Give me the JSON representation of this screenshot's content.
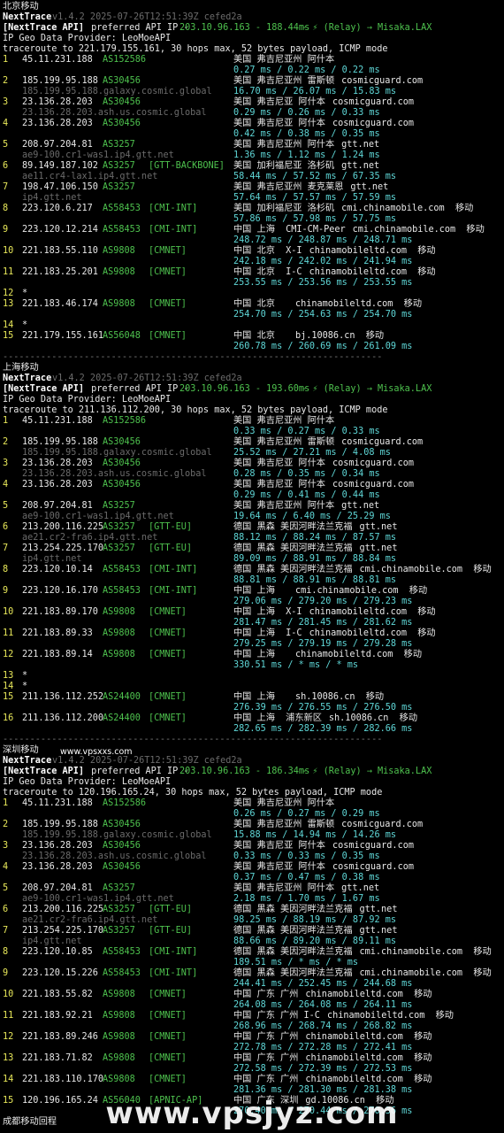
{
  "sections": [
    {
      "title": "北京移动",
      "app": "NextTrace",
      "version": "v1.4.2 2025-07-26T12:51:39Z cefed2a",
      "api_line": {
        "prefix": "[NextTrace API]",
        "text": " preferred API IP - ",
        "ip": "203.10.96.163 - 188.44ms",
        "relay": " - ⚡ (Relay) → Misaka.LAX"
      },
      "geo_provider": "IP Geo Data Provider: LeoMoeAPI",
      "traceroute": "traceroute to 221.179.155.161, 30 hops max, 52 bytes payload, ICMP mode",
      "hops": [
        {
          "n": "1",
          "ip": "45.11.231.188",
          "asn": "AS152586",
          "tag": "",
          "geo": "美国 弗吉尼亚州 阿什本",
          "org": "",
          "host": "",
          "rtt": "0.27 ms / 0.22 ms / 0.22 ms"
        },
        {
          "n": "2",
          "ip": "185.199.95.188",
          "asn": "AS30456",
          "tag": "",
          "geo": "美国 弗吉尼亚州 雷斯顿",
          "org": "cosmicguard.com",
          "host": "185.199.95.188.galaxy.cosmic.global",
          "rtt": "16.70 ms / 26.07 ms / 15.83 ms"
        },
        {
          "n": "3",
          "ip": "23.136.28.203",
          "asn": "AS30456",
          "tag": "",
          "geo": "美国 弗吉尼亚 阿什本",
          "org": "cosmicguard.com",
          "host": "23.136.28.203.ash.us.cosmic.global",
          "rtt": "0.29 ms / 0.26 ms / 0.33 ms"
        },
        {
          "n": "4",
          "ip": "23.136.28.203",
          "asn": "AS30456",
          "tag": "",
          "geo": "美国 弗吉尼亚 阿什本",
          "org": "cosmicguard.com",
          "host": "",
          "rtt": "0.42 ms / 0.38 ms / 0.35 ms"
        },
        {
          "n": "5",
          "ip": "208.97.204.81",
          "asn": "AS3257",
          "tag": "",
          "geo": "美国 弗吉尼亚州 阿什本",
          "org": "gtt.net",
          "host": "ae9-100.cr1-was1.ip4.gtt.net",
          "rtt": "1.36 ms / 1.12 ms / 1.24 ms"
        },
        {
          "n": "6",
          "ip": "89.149.187.102",
          "asn": "AS3257",
          "tag": "[GTT-BACKBONE]",
          "geo": "美国 加利福尼亚 洛杉矶",
          "org": "gtt.net",
          "host": "ae11.cr4-lax1.ip4.gtt.net",
          "rtt": "58.44 ms / 57.52 ms / 67.35 ms"
        },
        {
          "n": "7",
          "ip": "198.47.106.150",
          "asn": "AS3257",
          "tag": "",
          "geo": "美国 弗吉尼亚州 麦克莱恩",
          "org": "gtt.net",
          "host": "ip4.gtt.net",
          "rtt": "57.64 ms / 57.57 ms / 57.59 ms"
        },
        {
          "n": "8",
          "ip": "223.120.6.217",
          "asn": "AS58453",
          "tag": "[CMI-INT]",
          "geo": "美国 加利福尼亚 洛杉矶",
          "org": "cmi.chinamobile.com  移动",
          "host": "",
          "rtt": "57.86 ms / 57.98 ms / 57.75 ms"
        },
        {
          "n": "9",
          "ip": "223.120.12.214",
          "asn": "AS58453",
          "tag": "[CMI-INT]",
          "geo": "中国 上海  CMI-CM-Peer",
          "org": "cmi.chinamobile.com  移动",
          "host": "",
          "rtt": "248.72 ms / 248.87 ms / 248.71 ms"
        },
        {
          "n": "10",
          "ip": "221.183.55.110",
          "asn": "AS9808",
          "tag": "[CMNET]",
          "geo": "中国 北京  X-I",
          "org": "chinamobileltd.com  移动",
          "host": "",
          "rtt": "242.18 ms / 242.02 ms / 241.94 ms"
        },
        {
          "n": "11",
          "ip": "221.183.25.201",
          "asn": "AS9808",
          "tag": "[CMNET]",
          "geo": "中国 北京  I-C",
          "org": "chinamobileltd.com  移动",
          "host": "",
          "rtt": "253.55 ms / 253.56 ms / 253.55 ms"
        },
        {
          "n": "12",
          "ip": "*",
          "asn": "",
          "tag": "",
          "geo": "",
          "org": "",
          "host": "",
          "rtt": ""
        },
        {
          "n": "13",
          "ip": "221.183.46.174",
          "asn": "AS9808",
          "tag": "[CMNET]",
          "geo": "中国 北京",
          "org": "chinamobileltd.com  移动",
          "host": "",
          "rtt": "254.70 ms / 254.63 ms / 254.70 ms"
        },
        {
          "n": "14",
          "ip": "*",
          "asn": "",
          "tag": "",
          "geo": "",
          "org": "",
          "host": "",
          "rtt": ""
        },
        {
          "n": "15",
          "ip": "221.179.155.161",
          "asn": "AS56048",
          "tag": "[CMNET]",
          "geo": "中国 北京",
          "org": "bj.10086.cn  移动",
          "host": "",
          "rtt": "260.78 ms / 260.69 ms / 261.09 ms"
        }
      ]
    },
    {
      "title": "上海移动",
      "app": "NextTrace",
      "version": "v1.4.2 2025-07-26T12:51:39Z cefed2a",
      "api_line": {
        "prefix": "[NextTrace API]",
        "text": " preferred API IP - ",
        "ip": "203.10.96.163 - 193.60ms",
        "relay": " - ⚡ (Relay) → Misaka.LAX"
      },
      "geo_provider": "IP Geo Data Provider: LeoMoeAPI",
      "traceroute": "traceroute to 211.136.112.200, 30 hops max, 52 bytes payload, ICMP mode",
      "hops": [
        {
          "n": "1",
          "ip": "45.11.231.188",
          "asn": "AS152586",
          "tag": "",
          "geo": "美国 弗吉尼亚州 阿什本",
          "org": "",
          "host": "",
          "rtt": "0.33 ms / 0.27 ms / 0.33 ms"
        },
        {
          "n": "2",
          "ip": "185.199.95.188",
          "asn": "AS30456",
          "tag": "",
          "geo": "美国 弗吉尼亚州 雷斯顿",
          "org": "cosmicguard.com",
          "host": "185.199.95.188.galaxy.cosmic.global",
          "rtt": "25.52 ms / 27.21 ms / 4.08 ms"
        },
        {
          "n": "3",
          "ip": "23.136.28.203",
          "asn": "AS30456",
          "tag": "",
          "geo": "美国 弗吉尼亚 阿什本",
          "org": "cosmicguard.com",
          "host": "23.136.28.203.ash.us.cosmic.global",
          "rtt": "0.28 ms / 0.35 ms / 0.34 ms"
        },
        {
          "n": "4",
          "ip": "23.136.28.203",
          "asn": "AS30456",
          "tag": "",
          "geo": "美国 弗吉尼亚 阿什本",
          "org": "cosmicguard.com",
          "host": "",
          "rtt": "0.29 ms / 0.41 ms / 0.44 ms"
        },
        {
          "n": "5",
          "ip": "208.97.204.81",
          "asn": "AS3257",
          "tag": "",
          "geo": "美国 弗吉尼亚州 阿什本",
          "org": "gtt.net",
          "host": "ae9-100.cr1-was1.ip4.gtt.net",
          "rtt": "19.64 ms / 6.40 ms / 25.29 ms"
        },
        {
          "n": "6",
          "ip": "213.200.116.225",
          "asn": "AS3257",
          "tag": "[GTT-EU]",
          "geo": "德国 黑森 美因河畔法兰克福",
          "org": "gtt.net",
          "host": "ae21.cr2-fra6.ip4.gtt.net",
          "rtt": "88.12 ms / 88.24 ms / 87.57 ms"
        },
        {
          "n": "7",
          "ip": "213.254.225.170",
          "asn": "AS3257",
          "tag": "[GTT-EU]",
          "geo": "德国 黑森 美因河畔法兰克福",
          "org": "gtt.net",
          "host": "ip4.gtt.net",
          "rtt": "89.09 ms / 88.91 ms / 88.84 ms"
        },
        {
          "n": "8",
          "ip": "223.120.10.14",
          "asn": "AS58453",
          "tag": "[CMI-INT]",
          "geo": "德国 黑森 美因河畔法兰克福",
          "org": "cmi.chinamobile.com  移动",
          "host": "",
          "rtt": "88.81 ms / 88.91 ms / 88.81 ms"
        },
        {
          "n": "9",
          "ip": "223.120.16.170",
          "asn": "AS58453",
          "tag": "[CMI-INT]",
          "geo": "中国 上海",
          "org": "cmi.chinamobile.com  移动",
          "host": "",
          "rtt": "279.06 ms / 279.20 ms / 279.23 ms"
        },
        {
          "n": "10",
          "ip": "221.183.89.170",
          "asn": "AS9808",
          "tag": "[CMNET]",
          "geo": "中国 上海  X-I",
          "org": "chinamobileltd.com  移动",
          "host": "",
          "rtt": "281.47 ms / 281.45 ms / 281.62 ms"
        },
        {
          "n": "11",
          "ip": "221.183.89.33",
          "asn": "AS9808",
          "tag": "[CMNET]",
          "geo": "中国 上海  I-C",
          "org": "chinamobileltd.com  移动",
          "host": "",
          "rtt": "279.25 ms / 279.19 ms / 279.28 ms"
        },
        {
          "n": "12",
          "ip": "221.183.89.14",
          "asn": "AS9808",
          "tag": "[CMNET]",
          "geo": "中国 上海",
          "org": "chinamobileltd.com  移动",
          "host": "",
          "rtt": "330.51 ms / * ms / * ms"
        },
        {
          "n": "13",
          "ip": "*",
          "asn": "",
          "tag": "",
          "geo": "",
          "org": "",
          "host": "",
          "rtt": ""
        },
        {
          "n": "14",
          "ip": "*",
          "asn": "",
          "tag": "",
          "geo": "",
          "org": "",
          "host": "",
          "rtt": ""
        },
        {
          "n": "15",
          "ip": "211.136.112.252",
          "asn": "AS24400",
          "tag": "[CMNET]",
          "geo": "中国 上海",
          "org": "sh.10086.cn  移动",
          "host": "",
          "rtt": "276.39 ms / 276.55 ms / 276.50 ms"
        },
        {
          "n": "16",
          "ip": "211.136.112.200",
          "asn": "AS24400",
          "tag": "[CMNET]",
          "geo": "中国 上海  浦东新区",
          "org": "sh.10086.cn  移动",
          "host": "",
          "rtt": "282.65 ms / 282.39 ms / 282.66 ms"
        }
      ]
    },
    {
      "title": "深圳移动",
      "app": "NextTrace",
      "version": "v1.4.2 2025-07-26T12:51:39Z cefed2a",
      "api_line": {
        "prefix": "[NextTrace API]",
        "text": " preferred API IP - ",
        "ip": "203.10.96.163 - 186.34ms",
        "relay": " - ⚡ (Relay) → Misaka.LAX"
      },
      "geo_provider": "IP Geo Data Provider: LeoMoeAPI",
      "traceroute": "traceroute to 120.196.165.24, 30 hops max, 52 bytes payload, ICMP mode",
      "hops": [
        {
          "n": "1",
          "ip": "45.11.231.188",
          "asn": "AS152586",
          "tag": "",
          "geo": "美国 弗吉尼亚州 阿什本",
          "org": "",
          "host": "",
          "rtt": "0.26 ms / 0.27 ms / 0.29 ms"
        },
        {
          "n": "2",
          "ip": "185.199.95.188",
          "asn": "AS30456",
          "tag": "",
          "geo": "美国 弗吉尼亚州 雷斯顿",
          "org": "cosmicguard.com",
          "host": "185.199.95.188.galaxy.cosmic.global",
          "rtt": "15.88 ms / 14.94 ms / 14.26 ms"
        },
        {
          "n": "3",
          "ip": "23.136.28.203",
          "asn": "AS30456",
          "tag": "",
          "geo": "美国 弗吉尼亚 阿什本",
          "org": "cosmicguard.com",
          "host": "23.136.28.203.ash.us.cosmic.global",
          "rtt": "0.33 ms / 0.33 ms / 0.35 ms"
        },
        {
          "n": "4",
          "ip": "23.136.28.203",
          "asn": "AS30456",
          "tag": "",
          "geo": "美国 弗吉尼亚 阿什本",
          "org": "cosmicguard.com",
          "host": "",
          "rtt": "0.37 ms / 0.47 ms / 0.38 ms"
        },
        {
          "n": "5",
          "ip": "208.97.204.81",
          "asn": "AS3257",
          "tag": "",
          "geo": "美国 弗吉尼亚州 阿什本",
          "org": "gtt.net",
          "host": "ae9-100.cr1-was1.ip4.gtt.net",
          "rtt": "2.18 ms / 1.70 ms / 1.67 ms"
        },
        {
          "n": "6",
          "ip": "213.200.116.225",
          "asn": "AS3257",
          "tag": "[GTT-EU]",
          "geo": "德国 黑森 美因河畔法兰克福",
          "org": "gtt.net",
          "host": "ae21.cr2-fra6.ip4.gtt.net",
          "rtt": "98.25 ms / 88.19 ms / 87.92 ms"
        },
        {
          "n": "7",
          "ip": "213.254.225.170",
          "asn": "AS3257",
          "tag": "[GTT-EU]",
          "geo": "德国 黑森 美因河畔法兰克福",
          "org": "gtt.net",
          "host": "ip4.gtt.net",
          "rtt": "88.66 ms / 89.20 ms / 89.11 ms"
        },
        {
          "n": "8",
          "ip": "223.120.10.85",
          "asn": "AS58453",
          "tag": "[CMI-INT]",
          "geo": "德国 黑森 美因河畔法兰克福",
          "org": "cmi.chinamobile.com  移动",
          "host": "",
          "rtt": "189.51 ms / * ms / * ms"
        },
        {
          "n": "9",
          "ip": "223.120.15.226",
          "asn": "AS58453",
          "tag": "[CMI-INT]",
          "geo": "德国 黑森 美因河畔法兰克福",
          "org": "cmi.chinamobile.com  移动",
          "host": "",
          "rtt": "244.41 ms / 252.45 ms / 244.68 ms"
        },
        {
          "n": "10",
          "ip": "221.183.55.82",
          "asn": "AS9808",
          "tag": "[CMNET]",
          "geo": "中国 广东 广州",
          "org": "chinamobileltd.com  移动",
          "host": "",
          "rtt": "264.08 ms / 264.08 ms / 264.11 ms"
        },
        {
          "n": "11",
          "ip": "221.183.92.21",
          "asn": "AS9808",
          "tag": "[CMNET]",
          "geo": "中国 广东 广州 I-C",
          "org": "chinamobileltd.com  移动",
          "host": "",
          "rtt": "268.96 ms / 268.74 ms / 268.82 ms"
        },
        {
          "n": "12",
          "ip": "221.183.89.246",
          "asn": "AS9808",
          "tag": "[CMNET]",
          "geo": "中国 广东 广州",
          "org": "chinamobileltd.com  移动",
          "host": "",
          "rtt": "272.78 ms / 272.28 ms / 272.41 ms"
        },
        {
          "n": "13",
          "ip": "221.183.71.82",
          "asn": "AS9808",
          "tag": "[CMNET]",
          "geo": "中国 广东 广州",
          "org": "chinamobileltd.com  移动",
          "host": "",
          "rtt": "272.58 ms / 272.39 ms / 272.53 ms"
        },
        {
          "n": "14",
          "ip": "221.183.110.170",
          "asn": "AS9808",
          "tag": "[CMNET]",
          "geo": "中国 广东 广州",
          "org": "chinamobileltd.com  移动",
          "host": "",
          "rtt": "281.36 ms / 281.30 ms / 281.38 ms"
        },
        {
          "n": "15",
          "ip": "120.196.165.24",
          "asn": "AS56040",
          "tag": "[APNIC-AP]",
          "geo": "中国 广东 深圳",
          "org": "gd.10086.cn  移动",
          "host": "",
          "rtt": "270.40 ms / 270.44 ms / 270.36 ms"
        }
      ]
    }
  ],
  "separator": "----------------------------------------------------------------------",
  "watermark_small": "www.vpsxxs.com",
  "watermark": "www.vpsjyz.com",
  "footer_partial": "成都移动回程",
  "colors": {
    "background": "#000000",
    "number": "#e8e85a",
    "asn": "#4ec24e",
    "rtt": "#5fd7d7",
    "host": "#6b6b6b",
    "text": "#e8e8e8"
  }
}
